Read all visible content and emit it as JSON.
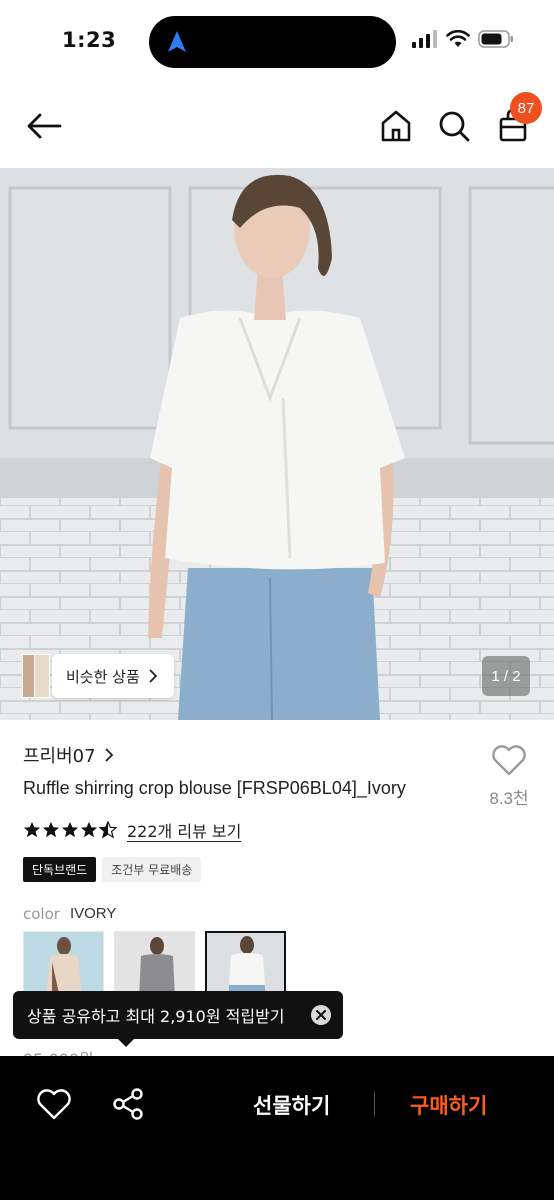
{
  "status_bar": {
    "time": "1:23"
  },
  "header": {
    "cart_badge": "87"
  },
  "hero": {
    "similar_label": "비슷한 상품",
    "pager": "1 / 2"
  },
  "product": {
    "brand": "프리버07",
    "title": "Ruffle shirring crop blouse [FRSP06BL04]_Ivory",
    "like_count": "8.3천",
    "rating": 4.5,
    "review_link": "222개 리뷰 보기",
    "tags": [
      "단독브랜드",
      "조건부 무료배송"
    ],
    "color_label": "color",
    "color_value": "IVORY",
    "price_peek": "95,000원"
  },
  "tooltip": {
    "text": "상품 공유하고 최대 2,910원 적립받기"
  },
  "bottom_bar": {
    "gift_label": "선물하기",
    "buy_label": "구매하기"
  },
  "colors": {
    "accent": "#f0501e",
    "buy": "#ff5b1f",
    "bar": "#000000"
  },
  "icons": [
    "navigation-arrow-icon",
    "signal-icon",
    "wifi-icon",
    "battery-icon",
    "back-arrow-icon",
    "home-icon",
    "search-icon",
    "cart-icon",
    "chevron-right-icon",
    "heart-icon",
    "star-icon",
    "close-icon",
    "share-icon"
  ]
}
